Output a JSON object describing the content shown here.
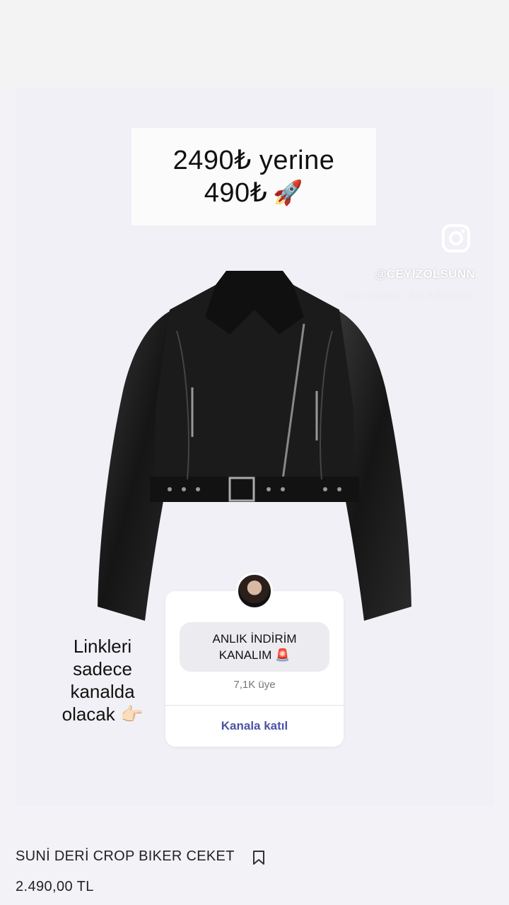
{
  "price_box": {
    "line1": "2490₺ yerine",
    "line2": "490₺",
    "emoji": "🚀"
  },
  "overlay": {
    "instagram_handle": "@CEYIZOLSUNN",
    "song": "Alex Guesta - My Addiction"
  },
  "promo_text": {
    "lines": [
      "Linkleri",
      "sadece",
      "kanalda",
      "olacak 👉🏻"
    ]
  },
  "channel_card": {
    "name_line1": "ANLIK İNDİRİM",
    "name_line2": "KANALIM 🚨",
    "members": "7,1K üye",
    "join_label": "Kanala katıl"
  },
  "product": {
    "title": "SUNİ DERİ CROP BIKER CEKET",
    "price": "2.490,00 TL"
  },
  "icons": {
    "instagram": "instagram-icon",
    "bookmark": "bookmark-icon",
    "rocket": "rocket-emoji"
  },
  "colors": {
    "join_link": "#4b53a6",
    "background": "#f3f2f7"
  }
}
